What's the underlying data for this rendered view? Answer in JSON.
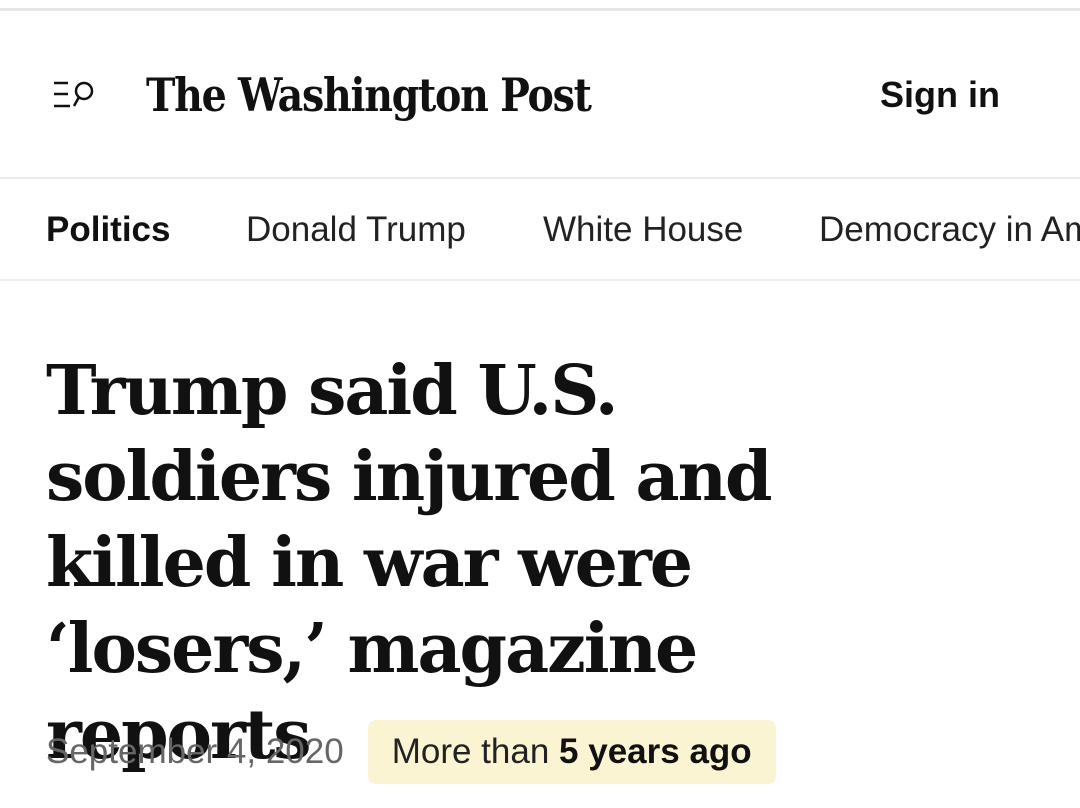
{
  "header": {
    "menu_icon": "menu-search-icon",
    "logo_text": "The Washington Post",
    "signin_label": "Sign in"
  },
  "nav": {
    "items": [
      {
        "label": "Politics",
        "active": true
      },
      {
        "label": "Donald Trump",
        "active": false
      },
      {
        "label": "White House",
        "active": false
      },
      {
        "label": "Democracy in America",
        "active": false
      }
    ]
  },
  "article": {
    "headline": "Trump said U.S. soldiers injured and killed in war were ‘losers,’ magazine reports",
    "date": "September 4, 2020",
    "age_prefix": "More than",
    "age_value": "5 years ago"
  },
  "colors": {
    "badge_background": "#fbf4d3",
    "text": "#111111",
    "date_text": "#666666",
    "divider": "#e9e9e9"
  }
}
